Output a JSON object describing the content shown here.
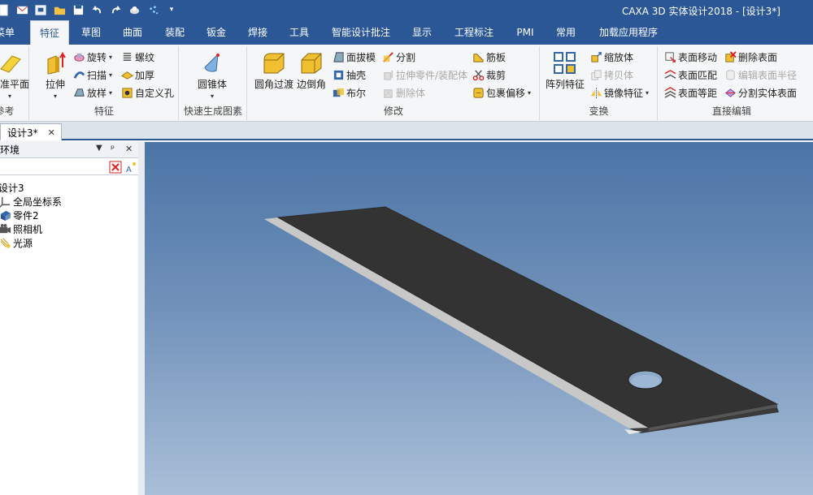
{
  "window": {
    "title": "CAXA 3D 实体设计2018 - [设计3*]"
  },
  "quick_access": [
    "new-icon",
    "mail-icon",
    "save-as-icon",
    "open-folder-icon",
    "save-icon",
    "undo-icon",
    "redo-icon",
    "render-icon",
    "sparkle-icon",
    "qat-dropdown-icon"
  ],
  "tabs": [
    {
      "label": "菜单"
    },
    {
      "label": "特征"
    },
    {
      "label": "草图"
    },
    {
      "label": "曲面"
    },
    {
      "label": "装配"
    },
    {
      "label": "钣金"
    },
    {
      "label": "焊接"
    },
    {
      "label": "工具"
    },
    {
      "label": "智能设计批注"
    },
    {
      "label": "显示"
    },
    {
      "label": "工程标注"
    },
    {
      "label": "PMI"
    },
    {
      "label": "常用"
    },
    {
      "label": "加载应用程序"
    }
  ],
  "ribbon": {
    "ref": {
      "plane_label": "基准平面",
      "group": "参考"
    },
    "feature": {
      "extrude": "拉伸",
      "revolve": "旋转",
      "sweep": "扫描",
      "loft": "放样",
      "thread": "螺纹",
      "thicken": "加厚",
      "custom_hole": "自定义孔",
      "group": "特征"
    },
    "quick": {
      "cone": "圆锥体",
      "group": "快速生成图素"
    },
    "modify": {
      "fillet": "圆角过渡",
      "chamfer": "边倒角",
      "draft": "面拔模",
      "shell": "抽壳",
      "boolean": "布尔",
      "split": "分割",
      "extrude_part": "拉伸零件/装配体",
      "delete_body": "删除体",
      "rib": "筋板",
      "trim": "裁剪",
      "wrap_offset": "包裹偏移",
      "group": "修改"
    },
    "transform": {
      "pattern": "阵列特征",
      "scale": "缩放体",
      "copy": "拷贝体",
      "mirror": "镜像特征",
      "group": "变换"
    },
    "direct": {
      "move_face": "表面移动",
      "delete_face": "删除表面",
      "match_face": "表面匹配",
      "edit_radius": "编辑表面半径",
      "offset_face": "表面等距",
      "split_solid": "分割实体表面",
      "group": "直接编辑"
    }
  },
  "document_tab": {
    "label": "设计3*"
  },
  "left_panel": {
    "title": "设计环境",
    "tree": [
      {
        "label": "设计3"
      },
      {
        "label": "全局坐标系"
      },
      {
        "label": "零件2"
      },
      {
        "label": "照相机"
      },
      {
        "label": "光源"
      }
    ]
  },
  "colors": {
    "ribbon_blue": "#2b5797",
    "blade_dark": "#333333",
    "blade_edge": "#c8c8c8"
  }
}
